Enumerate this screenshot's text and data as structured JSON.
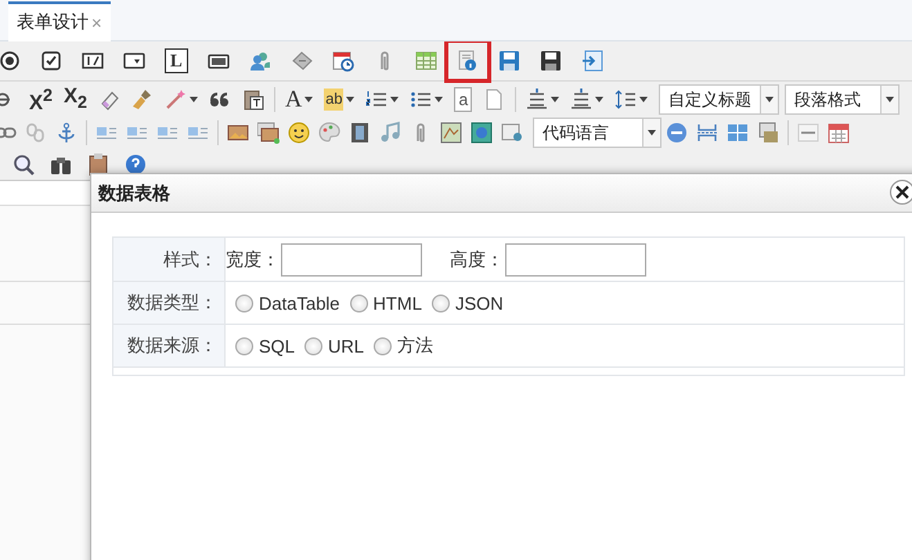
{
  "tabs": [
    {
      "label": "表单设计",
      "close": "×",
      "selected": true
    }
  ],
  "toolbar": {
    "rows": [
      {
        "items": [
          {
            "kind": "icon",
            "highlighted": false
          },
          {
            "kind": "icon",
            "highlighted": false
          },
          {
            "kind": "icon",
            "highlighted": false
          },
          {
            "kind": "icon",
            "highlighted": false
          },
          {
            "kind": "glyph",
            "text": "L",
            "highlighted": false
          },
          {
            "kind": "icon",
            "highlighted": false
          },
          {
            "kind": "icon",
            "highlighted": false
          },
          {
            "kind": "icon",
            "highlighted": false
          },
          {
            "kind": "icon",
            "highlighted": false
          },
          {
            "kind": "icon",
            "highlighted": false
          },
          {
            "kind": "icon",
            "highlighted": false
          },
          {
            "kind": "icon",
            "highlighted": true
          },
          {
            "kind": "icon",
            "highlighted": false
          },
          {
            "kind": "icon",
            "highlighted": false
          },
          {
            "kind": "icon",
            "highlighted": false
          }
        ]
      },
      {
        "items": [
          {
            "kind": "icon"
          },
          {
            "kind": "glyph",
            "text": "X$^{2}$"
          },
          {
            "kind": "glyph",
            "text": "X$_{2}$"
          },
          {
            "kind": "icon"
          },
          {
            "kind": "icon"
          },
          {
            "kind": "menu-icon"
          },
          {
            "kind": "icon"
          },
          {
            "kind": "icon"
          },
          {
            "kind": "separator"
          },
          {
            "kind": "menu-glyph",
            "text": "A"
          },
          {
            "kind": "menu-glyph",
            "text": "ab"
          },
          {
            "kind": "menu-icon"
          },
          {
            "kind": "menu-icon"
          },
          {
            "kind": "glyph",
            "text": "a"
          },
          {
            "kind": "icon"
          },
          {
            "kind": "separator"
          },
          {
            "kind": "menu-icon"
          },
          {
            "kind": "menu-icon"
          },
          {
            "kind": "menu-icon"
          },
          {
            "kind": "select",
            "value": "自定义标题"
          },
          {
            "kind": "select",
            "value": "段落格式"
          }
        ]
      },
      {
        "items": [
          {
            "kind": "icon"
          },
          {
            "kind": "icon"
          },
          {
            "kind": "icon"
          },
          {
            "kind": "separator"
          },
          {
            "kind": "icon"
          },
          {
            "kind": "icon"
          },
          {
            "kind": "icon"
          },
          {
            "kind": "icon"
          },
          {
            "kind": "separator"
          },
          {
            "kind": "icon"
          },
          {
            "kind": "icon"
          },
          {
            "kind": "icon"
          },
          {
            "kind": "icon"
          },
          {
            "kind": "icon"
          },
          {
            "kind": "icon"
          },
          {
            "kind": "icon"
          },
          {
            "kind": "icon"
          },
          {
            "kind": "icon"
          },
          {
            "kind": "icon"
          },
          {
            "kind": "select",
            "value": "代码语言"
          },
          {
            "kind": "icon"
          },
          {
            "kind": "icon"
          },
          {
            "kind": "icon"
          },
          {
            "kind": "icon"
          },
          {
            "kind": "separator"
          },
          {
            "kind": "icon"
          },
          {
            "kind": "icon"
          }
        ]
      },
      {
        "items": [
          {
            "kind": "icon"
          },
          {
            "kind": "icon"
          },
          {
            "kind": "icon"
          },
          {
            "kind": "icon"
          }
        ]
      }
    ]
  },
  "dialog": {
    "title": "数据表格",
    "rows": [
      {
        "label": "样式：",
        "kind": "fields",
        "fields": [
          {
            "label": "宽度："
          },
          {
            "label": "高度："
          }
        ]
      },
      {
        "label": "数据类型：",
        "kind": "radios",
        "options": [
          {
            "label": "DataTable",
            "selected": false
          },
          {
            "label": "HTML",
            "selected": false
          },
          {
            "label": "JSON",
            "selected": false
          }
        ]
      },
      {
        "label": "数据来源：",
        "kind": "radios",
        "options": [
          {
            "label": "SQL",
            "selected": false
          },
          {
            "label": "URL",
            "selected": false
          },
          {
            "label": "方法",
            "selected": false
          }
        ]
      }
    ]
  }
}
